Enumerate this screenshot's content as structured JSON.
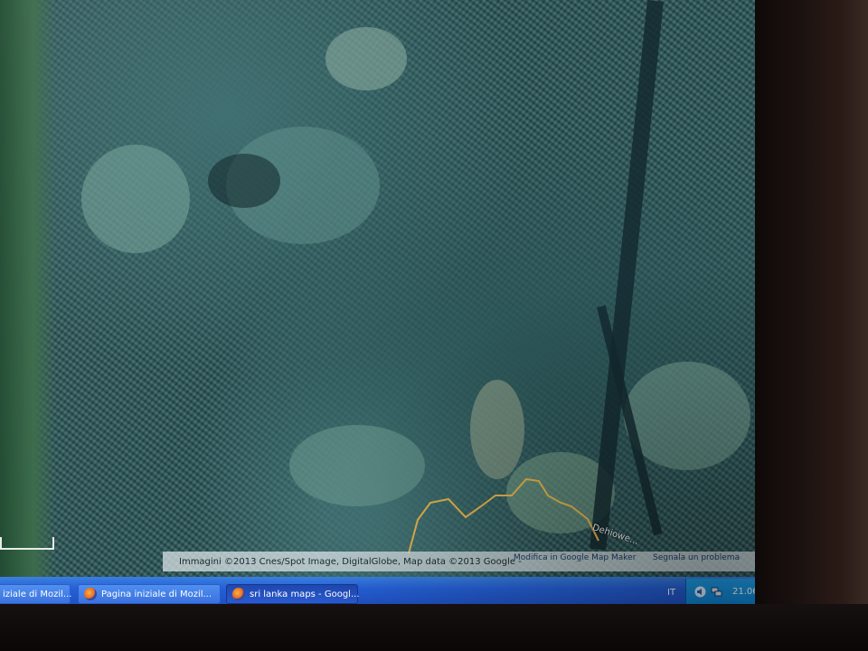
{
  "map": {
    "place_label": "Dehiowe...",
    "attribution": "Immagini ©2013 Cnes/Spot Image, DigitalGlobe, Map data ©2013 Google -",
    "edit_link": "Modifica in Google Map Maker",
    "report_link": "Segnala un problema"
  },
  "taskbar": {
    "buttons": [
      {
        "label": "iziale di Mozil..."
      },
      {
        "label": "Pagina iniziale di Mozil..."
      },
      {
        "label": "sri lanka maps - Googl..."
      }
    ],
    "language": "IT",
    "clock": "21.06"
  },
  "colors": {
    "taskbar": "#2560d6",
    "tray": "#0d86d8",
    "boundary": "#e2b24a"
  },
  "icons": [
    "firefox-icon",
    "network-icon",
    "volume-icon"
  ]
}
